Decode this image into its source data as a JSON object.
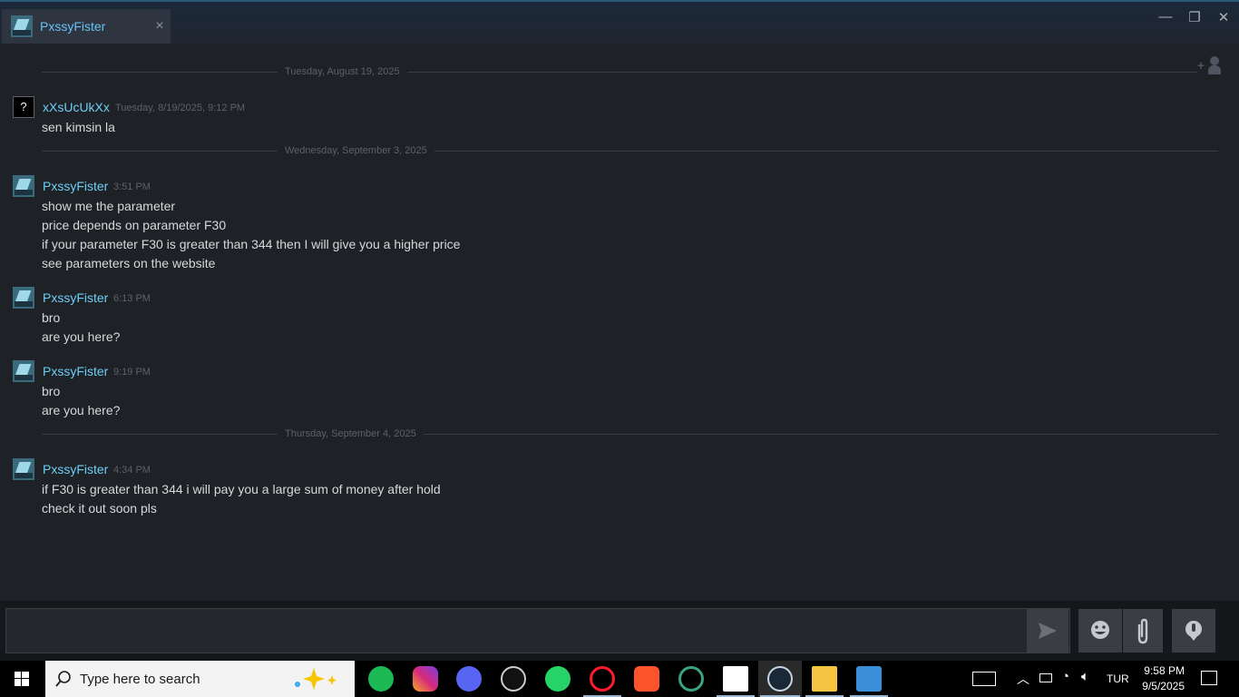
{
  "window": {
    "tab_label": "PxssyFister",
    "tab_close": "×",
    "minimize": "—",
    "maximize": "❐",
    "close": "✕"
  },
  "chat": {
    "dividers": [
      "Tuesday, August 19, 2025",
      "Wednesday, September 3, 2025",
      "Thursday, September 4, 2025"
    ],
    "messages": [
      {
        "author": "xXsUcUkXx",
        "time": "Tuesday, 8/19/2025, 9:12 PM",
        "avatar": "unknown-avatar",
        "avatar_glyph": "?",
        "lines": [
          "sen kimsin la"
        ]
      },
      {
        "author": "PxssyFister",
        "time": "3:51 PM",
        "avatar": "user-avatar",
        "lines": [
          "show me the parameter",
          "price depends on parameter F30",
          "if your parameter F30 is greater than 344 then I will give you a higher price",
          "see parameters on the website"
        ]
      },
      {
        "author": "PxssyFister",
        "time": "6:13 PM",
        "avatar": "user-avatar",
        "lines": [
          "bro",
          "are you here?"
        ]
      },
      {
        "author": "PxssyFister",
        "time": "9:19 PM",
        "avatar": "user-avatar",
        "lines": [
          "bro",
          "are you here?"
        ]
      },
      {
        "author": "PxssyFister",
        "time": "4:34 PM",
        "avatar": "user-avatar",
        "lines": [
          "if F30 is greater than 344 i will pay you a large sum of money after hold",
          "check it out soon pls"
        ]
      }
    ]
  },
  "composer": {
    "placeholder": "",
    "icons": [
      "send-icon",
      "emoji-icon",
      "attachment-icon",
      "voice-icon"
    ]
  },
  "taskbar": {
    "search_placeholder": "Type here to search",
    "apps": [
      "spotify-icon",
      "instagram-icon",
      "discord-icon",
      "speedtest-icon",
      "whatsapp-icon",
      "opera-icon",
      "brave-icon",
      "opera-gx-icon",
      "alienware-icon",
      "steam-icon",
      "file-explorer-icon",
      "photos-icon"
    ],
    "language": "TUR",
    "time": "9:58 PM",
    "date": "9/5/2025",
    "colors": {
      "spotify": "#1db954",
      "instagram": "#d6297a",
      "discord": "#5865f2",
      "whatsapp": "#25d366",
      "opera": "#ff1b2d",
      "brave": "#fb542b",
      "accent": "#67c1f5"
    }
  }
}
